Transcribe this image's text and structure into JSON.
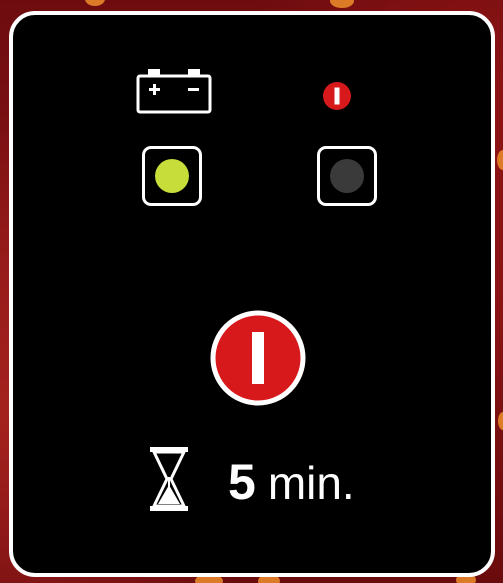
{
  "panel": {
    "battery_icon": "battery-icon",
    "alert_icon": "power-alert-icon",
    "battery_lamp": {
      "state": "on",
      "color": "#c6dd3a"
    },
    "fault_lamp": {
      "state": "off",
      "color": "#3a3a3a"
    },
    "power_button": {
      "icon": "power-icon",
      "color": "#d7191c"
    },
    "timer": {
      "icon": "hourglass-icon",
      "value": "5",
      "unit": "min."
    }
  },
  "colors": {
    "panel_bg": "#000000",
    "panel_border": "#ffffff",
    "accent_red": "#d7191c",
    "lamp_green": "#c6dd3a",
    "lamp_off": "#3a3a3a"
  }
}
